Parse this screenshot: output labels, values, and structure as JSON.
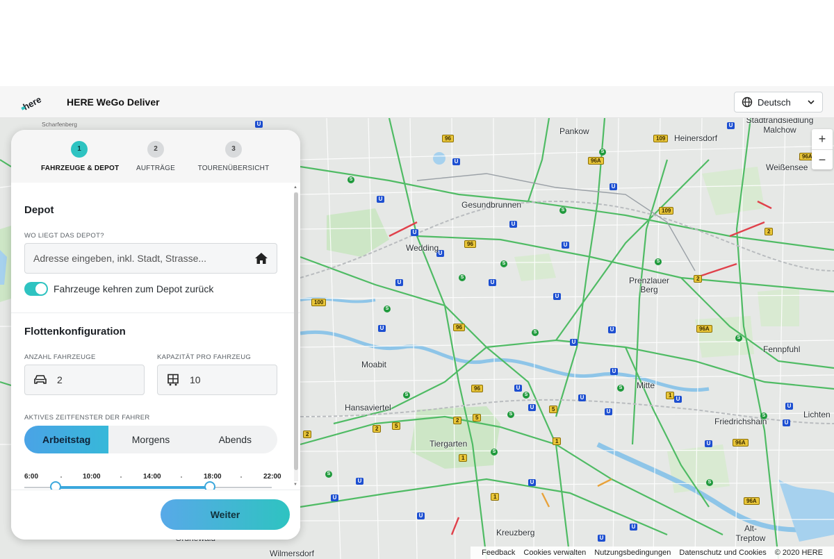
{
  "header": {
    "logo_text": "here",
    "app_title": "HERE WeGo Deliver",
    "language": "Deutsch"
  },
  "stepper": {
    "steps": [
      {
        "number": "1",
        "label": "FAHRZEUGE & DEPOT",
        "active": true
      },
      {
        "number": "2",
        "label": "AUFTRÄGE",
        "active": false
      },
      {
        "number": "3",
        "label": "TOURENÜBERSICHT",
        "active": false
      }
    ]
  },
  "depot": {
    "title": "Depot",
    "address_label": "WO LIEGT DAS DEPOT?",
    "address_placeholder": "Adresse eingeben, inkl. Stadt, Strasse...",
    "return_toggle_label": "Fahrzeuge kehren zum Depot zurück",
    "return_toggle_on": true
  },
  "fleet": {
    "title": "Flottenkonfiguration",
    "vehicles_label": "ANZAHL FAHRZEUGE",
    "vehicles_value": "2",
    "capacity_label": "KAPAZITÄT PRO FAHRZEUG",
    "capacity_value": "10",
    "time_window_label": "AKTIVES ZEITFENSTER DER FAHRER",
    "time_options": [
      "Arbeitstag",
      "Morgens",
      "Abends"
    ],
    "time_selected": "Arbeitstag",
    "timeline_ticks": [
      "6:00",
      "10:00",
      "14:00",
      "18:00",
      "22:00"
    ],
    "range_start_fraction": 0.125,
    "range_end_fraction": 0.75
  },
  "actions": {
    "next_label": "Weiter"
  },
  "map": {
    "labels": {
      "pankow": "Pankow",
      "heinersdorf": "Heinersdorf",
      "malchow": "Stadtrandsiedlung Malchow",
      "weissensee": "Weißensee",
      "gesundbrunnen": "Gesundbrunnen",
      "wedding": "Wedding",
      "prenzlauer": "Prenzlauer Berg",
      "moabit": "Moabit",
      "mitte": "Mitte",
      "hansaviertel": "Hansaviertel",
      "tiergarten": "Tiergarten",
      "friedrichshain": "Friedrichshain",
      "fennpfuhl": "Fennpfuhl",
      "kreuzberg": "Kreuzberg",
      "alt_treptow": "Alt-Treptow",
      "wilmersdorf": "Wilmersdorf",
      "grunewald": "Grunewald",
      "lichten": "Lichten",
      "scharfenberg": "Scharfenberg"
    },
    "zoom_in": "+",
    "zoom_out": "−"
  },
  "footer": {
    "links": [
      "Feedback",
      "Cookies verwalten",
      "Nutzungsbedingungen",
      "Datenschutz und Cookies"
    ],
    "copyright": "© 2020 HERE"
  },
  "colors": {
    "accent_teal": "#2ec3c1",
    "accent_blue": "#4aa3e6"
  }
}
